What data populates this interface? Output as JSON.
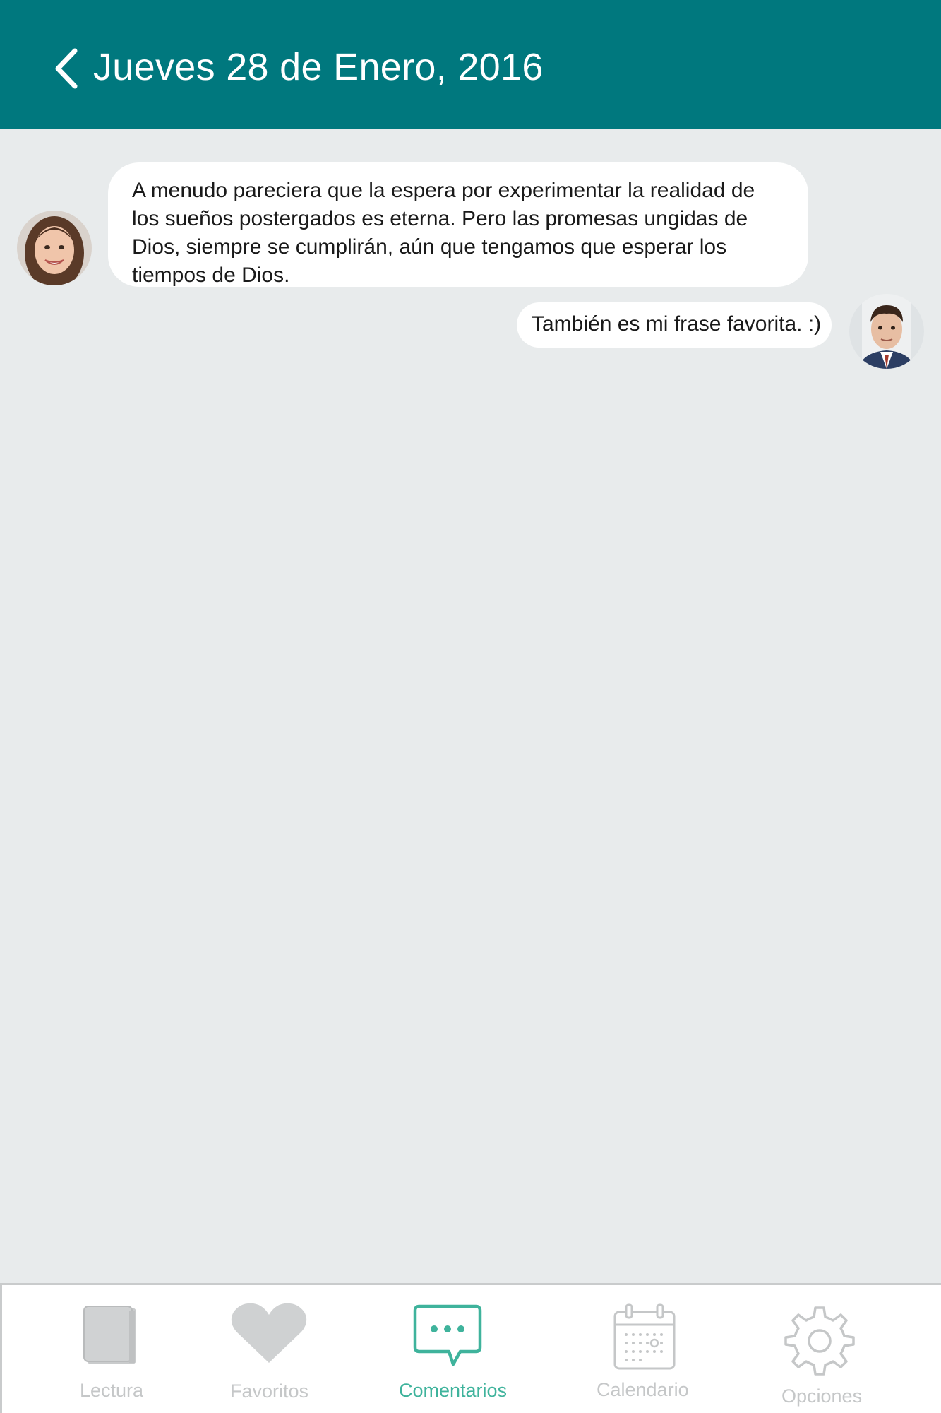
{
  "header": {
    "title": "Jueves 28 de Enero, 2016",
    "background": "#00787e"
  },
  "messages": [
    {
      "side": "left",
      "text": "A menudo pareciera que la espera por experimentar la realidad de los sueños postergados es eterna. Pero las promesas ungidas de Dios, siempre se cumplirán, aún que tengamos que esperar los tiempos de Dios."
    },
    {
      "side": "right",
      "text": "También es mi frase favorita. :)"
    }
  ],
  "tabbar": {
    "active_color": "#3fb39c",
    "inactive_color": "#c5c7c8",
    "tabs": [
      {
        "label": "Lectura",
        "icon": "book-icon",
        "active": false
      },
      {
        "label": "Favoritos",
        "icon": "heart-icon",
        "active": false
      },
      {
        "label": "Comentarios",
        "icon": "chat-bubble-icon",
        "active": true
      },
      {
        "label": "Calendario",
        "icon": "calendar-icon",
        "active": false
      },
      {
        "label": "Opciones",
        "icon": "gear-icon",
        "active": false
      }
    ]
  }
}
